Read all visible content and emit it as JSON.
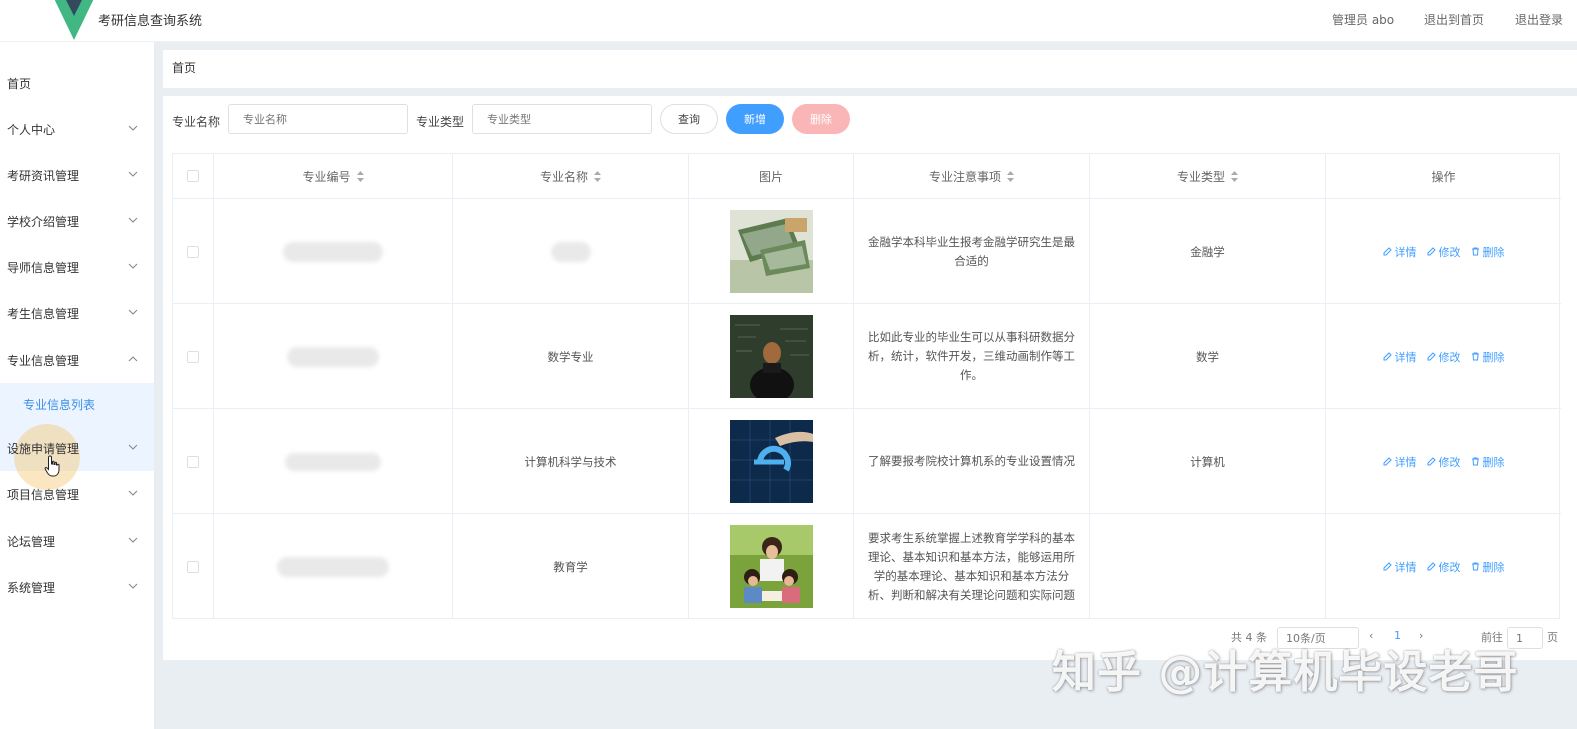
{
  "header": {
    "app_title": "考研信息查询系统",
    "admin_label": "管理员 abo",
    "back_home": "退出到首页",
    "logout": "退出登录"
  },
  "sidebar": {
    "items": [
      {
        "label": "首页",
        "has_chevron": false
      },
      {
        "label": "个人中心",
        "has_chevron": true
      },
      {
        "label": "考研资讯管理",
        "has_chevron": true
      },
      {
        "label": "学校介绍管理",
        "has_chevron": true
      },
      {
        "label": "导师信息管理",
        "has_chevron": true
      },
      {
        "label": "考生信息管理",
        "has_chevron": true
      },
      {
        "label": "专业信息管理",
        "has_chevron": true,
        "expanded": true
      },
      {
        "label": "设施申请管理",
        "has_chevron": true
      },
      {
        "label": "项目信息管理",
        "has_chevron": true
      },
      {
        "label": "论坛管理",
        "has_chevron": true
      },
      {
        "label": "系统管理",
        "has_chevron": true
      }
    ],
    "subitem": "专业信息列表"
  },
  "breadcrumb": "首页",
  "search": {
    "name_label": "专业名称",
    "name_placeholder": "专业名称",
    "type_label": "专业类型",
    "type_placeholder": "专业类型",
    "query_btn": "查询",
    "add_btn": "新增",
    "delete_btn": "删除"
  },
  "table": {
    "columns": [
      "专业编号",
      "专业名称",
      "图片",
      "专业注意事项",
      "专业类型",
      "操作"
    ],
    "rows": [
      {
        "name": "",
        "note": "金融学本科毕业生报考金融学研究生是最合适的",
        "type": "金融学",
        "image": "money-photo"
      },
      {
        "name": "数学专业",
        "note": "比如此专业的毕业生可以从事科研数据分析，统计，软件开发，三维动画制作等工作。",
        "type": "数学",
        "image": "chalkboard-photo"
      },
      {
        "name": "计算机科学与技术",
        "note": "了解要报考院校计算机系的专业设置情况",
        "type": "计算机",
        "image": "ie-logo-photo"
      },
      {
        "name": "教育学",
        "note": "要求考生系统掌握上述教育学学科的基本理论、基本知识和基本方法，能够运用所学的基本理论、基本知识和基本方法分析、判断和解决有关理论问题和实际问题",
        "type": "",
        "image": "mother-children-photo"
      }
    ],
    "ops": {
      "detail": "详情",
      "edit": "修改",
      "delete": "删除"
    }
  },
  "pagination": {
    "total": "共 4 条",
    "page_size": "10条/页",
    "goto": "前往",
    "page": "1",
    "page_suffix": "页"
  },
  "watermark": "知乎 @计算机毕设老哥",
  "colors": {
    "accent": "#409eff",
    "danger_light": "#fab6b6",
    "active_bg": "#ecf5ff"
  }
}
